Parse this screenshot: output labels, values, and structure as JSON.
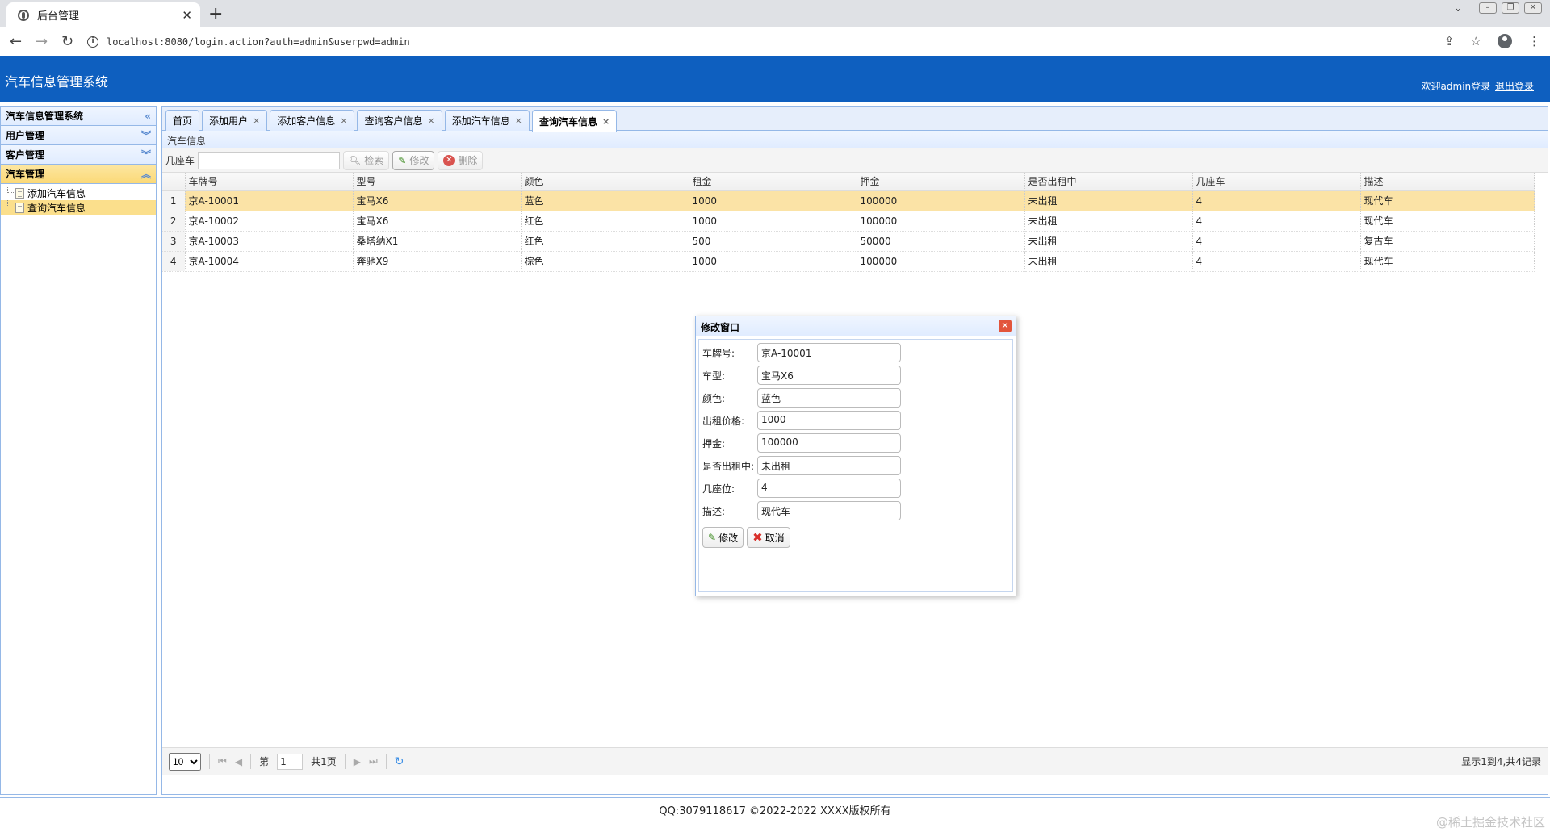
{
  "browser": {
    "tab_title": "后台管理",
    "url": "localhost:8080/login.action?auth=admin&userpwd=admin"
  },
  "header": {
    "title": "汽车信息管理系统",
    "welcome": "欢迎admin登录",
    "logout": "退出登录"
  },
  "sidebar": {
    "title": "汽车信息管理系统",
    "sections": [
      {
        "label": "用户管理"
      },
      {
        "label": "客户管理"
      },
      {
        "label": "汽车管理"
      }
    ],
    "tree": [
      "添加汽车信息",
      "查询汽车信息"
    ]
  },
  "tabs": [
    "首页",
    "添加用户",
    "添加客户信息",
    "查询客户信息",
    "添加汽车信息",
    "查询汽车信息"
  ],
  "content": {
    "title": "汽车信息",
    "search_label": "几座车",
    "search_button": "检索",
    "edit_button": "修改",
    "delete_button": "删除"
  },
  "table": {
    "headers": [
      "车牌号",
      "型号",
      "颜色",
      "租金",
      "押金",
      "是否出租中",
      "几座车",
      "描述"
    ],
    "rows": [
      {
        "n": "1",
        "cells": [
          "京A-10001",
          "宝马X6",
          "蓝色",
          "1000",
          "100000",
          "未出租",
          "4",
          "现代车"
        ]
      },
      {
        "n": "2",
        "cells": [
          "京A-10002",
          "宝马X6",
          "红色",
          "1000",
          "100000",
          "未出租",
          "4",
          "现代车"
        ]
      },
      {
        "n": "3",
        "cells": [
          "京A-10003",
          "桑塔纳X1",
          "红色",
          "500",
          "50000",
          "未出租",
          "4",
          "复古车"
        ]
      },
      {
        "n": "4",
        "cells": [
          "京A-10004",
          "奔驰X9",
          "棕色",
          "1000",
          "100000",
          "未出租",
          "4",
          "现代车"
        ]
      }
    ]
  },
  "pager": {
    "page_size": "10",
    "page_prefix": "第",
    "page_value": "1",
    "page_total": "共1页",
    "info": "显示1到4,共4记录"
  },
  "dialog": {
    "title": "修改窗口",
    "fields": [
      {
        "label": "车牌号:",
        "value": "京A-10001"
      },
      {
        "label": "车型:",
        "value": "宝马X6"
      },
      {
        "label": "颜色:",
        "value": "蓝色"
      },
      {
        "label": "出租价格:",
        "value": "1000"
      },
      {
        "label": "押金:",
        "value": "100000"
      },
      {
        "label": "是否出租中:",
        "value": "未出租"
      },
      {
        "label": "几座位:",
        "value": "4"
      },
      {
        "label": "描述:",
        "value": "现代车"
      }
    ],
    "save_label": "修改",
    "cancel_label": "取消"
  },
  "footer": "QQ:3079118617 ©2022-2022 XXXX版权所有",
  "watermark": "@稀土掘金技术社区"
}
